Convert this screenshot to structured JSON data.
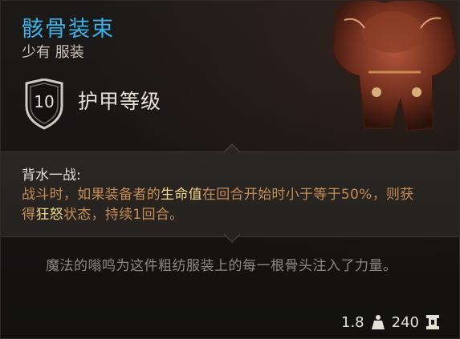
{
  "item": {
    "name": "骸骨装束",
    "rarity": "少有",
    "type": "服装",
    "armor_class": "10",
    "armor_label": "护甲等级",
    "passive": {
      "name": "背水一战:",
      "desc_part1": "战斗时，如果装备者的",
      "desc_hl1": "生命值",
      "desc_part2": "在回合开始时小于等于50%，则获得",
      "desc_hl2": "狂怒",
      "desc_part3": "状态，持续1回合。"
    },
    "flavor": "魔法的嗡鸣为这件粗纺服装上的每一根骨头注入了力量。",
    "weight": "1.8",
    "value": "240"
  },
  "colors": {
    "title": "#3fb1e6",
    "passive_text": "#c68d55",
    "highlight": "#f2d789",
    "flavor": "#8d8883"
  },
  "icons": {
    "armor_class": "shield-icon",
    "weight": "weight-icon",
    "value": "gold-coin-stack-icon"
  }
}
